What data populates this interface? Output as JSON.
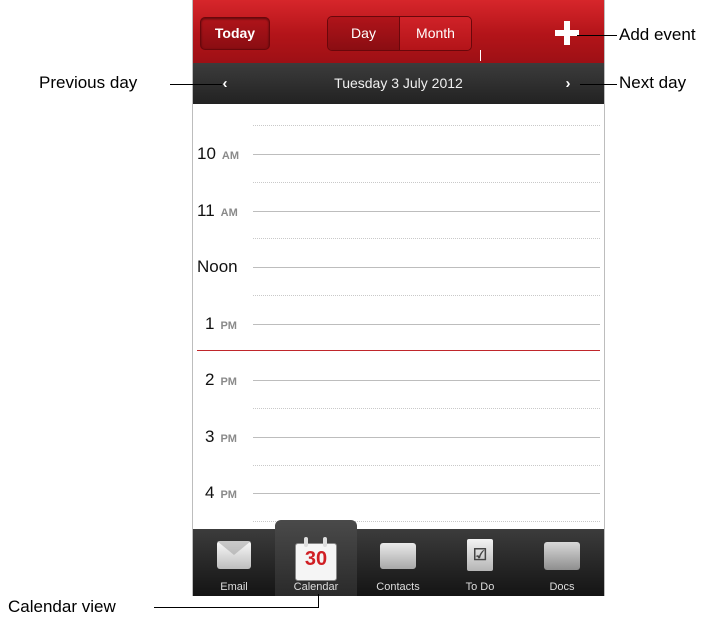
{
  "toolbar": {
    "today_label": "Today",
    "segments": [
      "Day",
      "Month"
    ],
    "add_icon": "plus-icon"
  },
  "datebar": {
    "title": "Tuesday 3 July 2012",
    "prev_icon": "‹",
    "next_icon": "›"
  },
  "day_view": {
    "hours": [
      {
        "label": "10",
        "ampm": "AM"
      },
      {
        "label": "11",
        "ampm": "AM"
      },
      {
        "label": "Noon",
        "ampm": ""
      },
      {
        "label": "1",
        "ampm": "PM"
      },
      {
        "label": "2",
        "ampm": "PM"
      },
      {
        "label": "3",
        "ampm": "PM"
      },
      {
        "label": "4",
        "ampm": "PM"
      }
    ],
    "current_time_line_color": "#c0262b"
  },
  "tabs": [
    {
      "label": "Email",
      "icon": "email-icon",
      "active": false
    },
    {
      "label": "Calendar",
      "icon": "calendar-icon",
      "active": true,
      "badge": "30"
    },
    {
      "label": "Contacts",
      "icon": "contacts-icon",
      "active": false
    },
    {
      "label": "To Do",
      "icon": "todo-icon",
      "active": false
    },
    {
      "label": "Docs",
      "icon": "docs-icon",
      "active": false
    }
  ],
  "annotations": {
    "add_event": "Add event",
    "previous_day": "Previous day",
    "next_day": "Next day",
    "calendar_view": "Calendar view"
  },
  "colors": {
    "accent_red": "#b31419",
    "dark_bar": "#2a2a2a"
  }
}
